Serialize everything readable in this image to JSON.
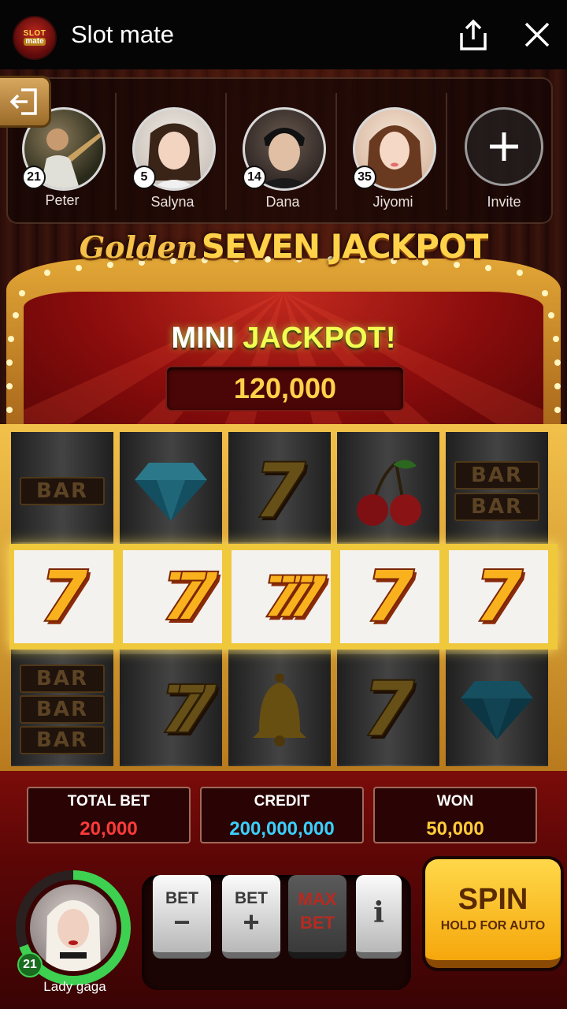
{
  "app": {
    "title": "Slot mate",
    "logo_text_top": "SLOT",
    "logo_text_bottom": "mate"
  },
  "friends": [
    {
      "name": "Peter",
      "level": "21"
    },
    {
      "name": "Salyna",
      "level": "5"
    },
    {
      "name": "Dana",
      "level": "14"
    },
    {
      "name": "Jiyomi",
      "level": "35"
    }
  ],
  "invite_label": "Invite",
  "jackpot": {
    "title_script": "Golden",
    "title_main": "SEVEN JACKPOT",
    "mini_word": "MINI",
    "jackpot_word": "JACKPOT!",
    "amount": "120,000"
  },
  "reels": {
    "bar_label": "BAR"
  },
  "stats": {
    "total_bet_label": "TOTAL BET",
    "total_bet_value": "20,000",
    "credit_label": "CREDIT",
    "credit_value": "200,000,000",
    "won_label": "WON",
    "won_value": "50,000"
  },
  "player": {
    "name": "Lady gaga",
    "level": "21"
  },
  "controls": {
    "bet_minus_label": "BET",
    "bet_minus_symbol": "−",
    "bet_plus_label": "BET",
    "bet_plus_symbol": "+",
    "max_bet_line1": "MAX",
    "max_bet_line2": "BET",
    "info_symbol": "i",
    "spin_label": "SPIN",
    "spin_sub": "HOLD FOR AUTO"
  },
  "colors": {
    "total_bet": "#ff3a3a",
    "credit": "#3ad0ff",
    "won": "#ffcc3a",
    "level_ring": "#3ed050"
  },
  "icons": {
    "share": "share-icon",
    "close": "close-icon",
    "exit": "exit-icon"
  }
}
